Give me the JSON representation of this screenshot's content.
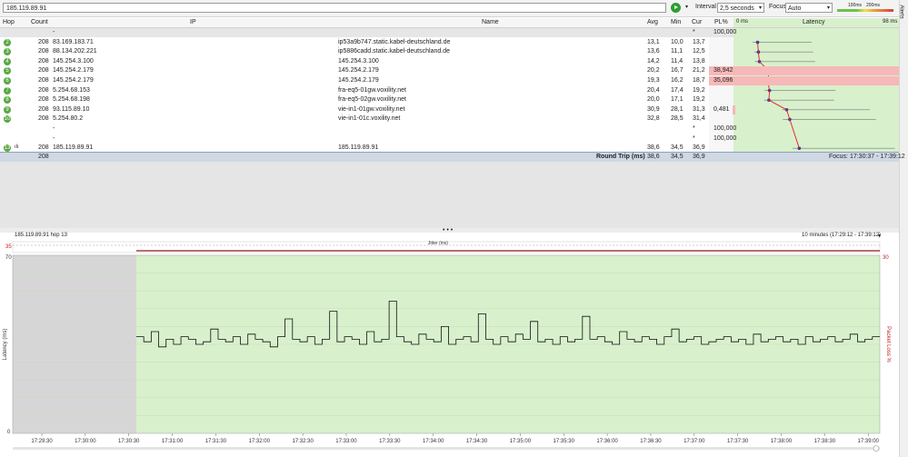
{
  "toolbar": {
    "target": "185.119.89.91",
    "interval_label": "Interval",
    "interval_value": "2,5 seconds",
    "focus_label": "Focus",
    "focus_value": "Auto",
    "scale_100": "100ms",
    "scale_200": "200ms",
    "alerts_label": "Alerts"
  },
  "table": {
    "columns": [
      "Hop",
      "Count",
      "IP",
      "Name",
      "Avg",
      "Min",
      "Cur",
      "PL%",
      "0 ms",
      "Latency",
      "98 ms"
    ],
    "rows": [
      {
        "hop": "",
        "count": "",
        "ip": "-",
        "name": "",
        "avg": "",
        "min": "",
        "cur": "*",
        "pl": "100,000",
        "first": true
      },
      {
        "hop": "2",
        "count": "208",
        "ip": "83.169.183.71",
        "name": "ip53a9b747.static.kabel-deutschland.de",
        "avg": "13,1",
        "min": "10,0",
        "cur": "13,7",
        "pl": ""
      },
      {
        "hop": "3",
        "count": "208",
        "ip": "88.134.202.221",
        "name": "ip5886cadd.static.kabel-deutschland.de",
        "avg": "13,6",
        "min": "11,1",
        "cur": "12,5",
        "pl": ""
      },
      {
        "hop": "4",
        "count": "208",
        "ip": "145.254.3.100",
        "name": "145.254.3.100",
        "avg": "14,2",
        "min": "11,4",
        "cur": "13,8",
        "pl": ""
      },
      {
        "hop": "5",
        "count": "208",
        "ip": "145.254.2.179",
        "name": "145.254.2.179",
        "avg": "20,2",
        "min": "16,7",
        "cur": "21,2",
        "pl": "38,942"
      },
      {
        "hop": "6",
        "count": "208",
        "ip": "145.254.2.179",
        "name": "145.254.2.179",
        "avg": "19,3",
        "min": "16,2",
        "cur": "18,7",
        "pl": "35,096"
      },
      {
        "hop": "7",
        "count": "208",
        "ip": "5.254.68.153",
        "name": "fra-eq5-01gw.voxility.net",
        "avg": "20,4",
        "min": "17,4",
        "cur": "19,2",
        "pl": ""
      },
      {
        "hop": "8",
        "count": "208",
        "ip": "5.254.68.198",
        "name": "fra-eq5-02gw.voxility.net",
        "avg": "20,0",
        "min": "17,1",
        "cur": "19,2",
        "pl": ""
      },
      {
        "hop": "9",
        "count": "208",
        "ip": "93.115.89.10",
        "name": "vie-in1-01gw.voxility.net",
        "avg": "30,9",
        "min": "28,1",
        "cur": "31,3",
        "pl": "0,481"
      },
      {
        "hop": "10",
        "count": "208",
        "ip": "5.254.80.2",
        "name": "vie-in1-01c.voxility.net",
        "avg": "32,8",
        "min": "28,5",
        "cur": "31,4",
        "pl": ""
      },
      {
        "hop": "",
        "count": "",
        "ip": "-",
        "name": "",
        "avg": "",
        "min": "",
        "cur": "*",
        "pl": "100,000"
      },
      {
        "hop": "",
        "count": "",
        "ip": "-",
        "name": "",
        "avg": "",
        "min": "",
        "cur": "*",
        "pl": "100,000"
      },
      {
        "hop": "13",
        "count": "208",
        "ip": "185.119.89.91",
        "name": "185.119.89.91",
        "avg": "38,6",
        "min": "34,5",
        "cur": "36,9",
        "pl": ""
      }
    ],
    "summary": {
      "count": "208",
      "label": "Round Trip (ms)",
      "avg": "38,6",
      "min": "34,5",
      "cur": "36,9",
      "focus": "Focus: 17:30:37 - 17:39:12"
    }
  },
  "chart": {
    "title": "185.119.89.91 hop 13",
    "range": "10 minutes (17:29:12 - 17:39:12)",
    "jitter_label": "Jitter (ms)",
    "jitter_max": "35",
    "y_max": "70",
    "y_min": "0",
    "pl_right": "30",
    "y_label": "Latency (ms)",
    "y2_label": "Packet Loss %",
    "x_ticks": [
      "17:29:30",
      "17:30:00",
      "17:30:30",
      "17:31:00",
      "17:31:30",
      "17:32:00",
      "17:32:30",
      "17:33:00",
      "17:33:30",
      "17:34:00",
      "17:34:30",
      "17:35:00",
      "17:35:30",
      "17:36:00",
      "17:36:30",
      "17:37:00",
      "17:37:30",
      "17:38:00",
      "17:38:30",
      "17:39:00"
    ]
  },
  "chart_data": {
    "type": "line",
    "title": "185.119.89.91 hop 13",
    "ylabel": "Latency (ms)",
    "ylim": [
      0,
      70
    ],
    "x_range": [
      "17:29:12",
      "17:39:12"
    ],
    "no_data_until": "17:30:37",
    "series": [
      {
        "values": [
          38,
          36,
          40,
          34,
          37,
          35,
          38,
          37,
          35,
          36,
          41,
          37,
          36,
          38,
          35,
          39,
          37,
          36,
          34,
          38,
          45,
          37,
          36,
          38,
          35,
          37,
          48,
          36,
          38,
          37,
          35,
          40,
          36,
          37,
          52,
          38,
          36,
          35,
          39,
          37,
          36,
          42,
          35,
          37,
          38,
          36,
          47,
          37,
          35,
          38,
          36,
          39,
          37,
          44,
          36,
          37,
          35,
          38,
          36,
          37,
          46,
          37,
          38,
          36,
          35,
          40,
          37,
          36,
          38,
          37,
          35,
          38,
          41,
          36,
          37,
          38,
          35,
          36,
          37,
          38,
          36,
          37,
          35,
          39,
          36,
          37,
          38,
          36,
          37,
          35,
          38,
          36,
          37,
          38,
          36,
          37,
          39,
          36,
          37,
          38
        ]
      }
    ]
  }
}
